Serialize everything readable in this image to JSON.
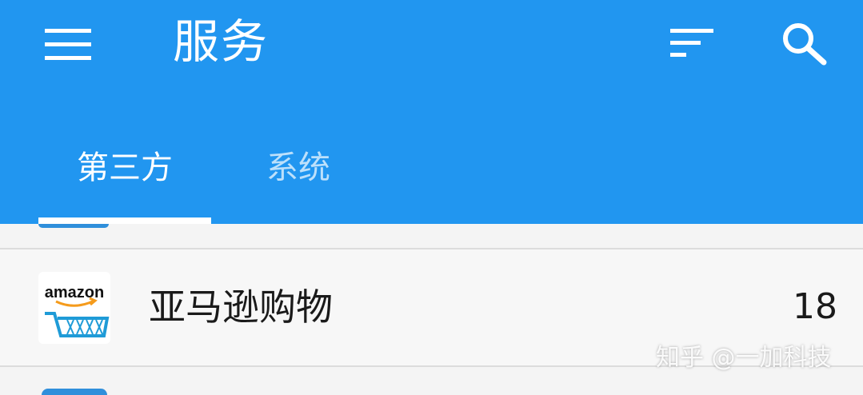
{
  "app_bar": {
    "title": "服务",
    "background_color": "#2196f0",
    "menu_icon": "menu-icon",
    "sort_icon": "sort-icon",
    "search_icon": "search-icon"
  },
  "tabs": [
    {
      "label": "第三方",
      "selected": true
    },
    {
      "label": "系统",
      "selected": false
    }
  ],
  "list": {
    "items": [
      {
        "name": "亚马逊购物",
        "count": "18",
        "icon": "amazon-logo-icon",
        "icon_text": "amazon"
      }
    ]
  },
  "watermark": {
    "text": "知乎 @一加科技"
  }
}
